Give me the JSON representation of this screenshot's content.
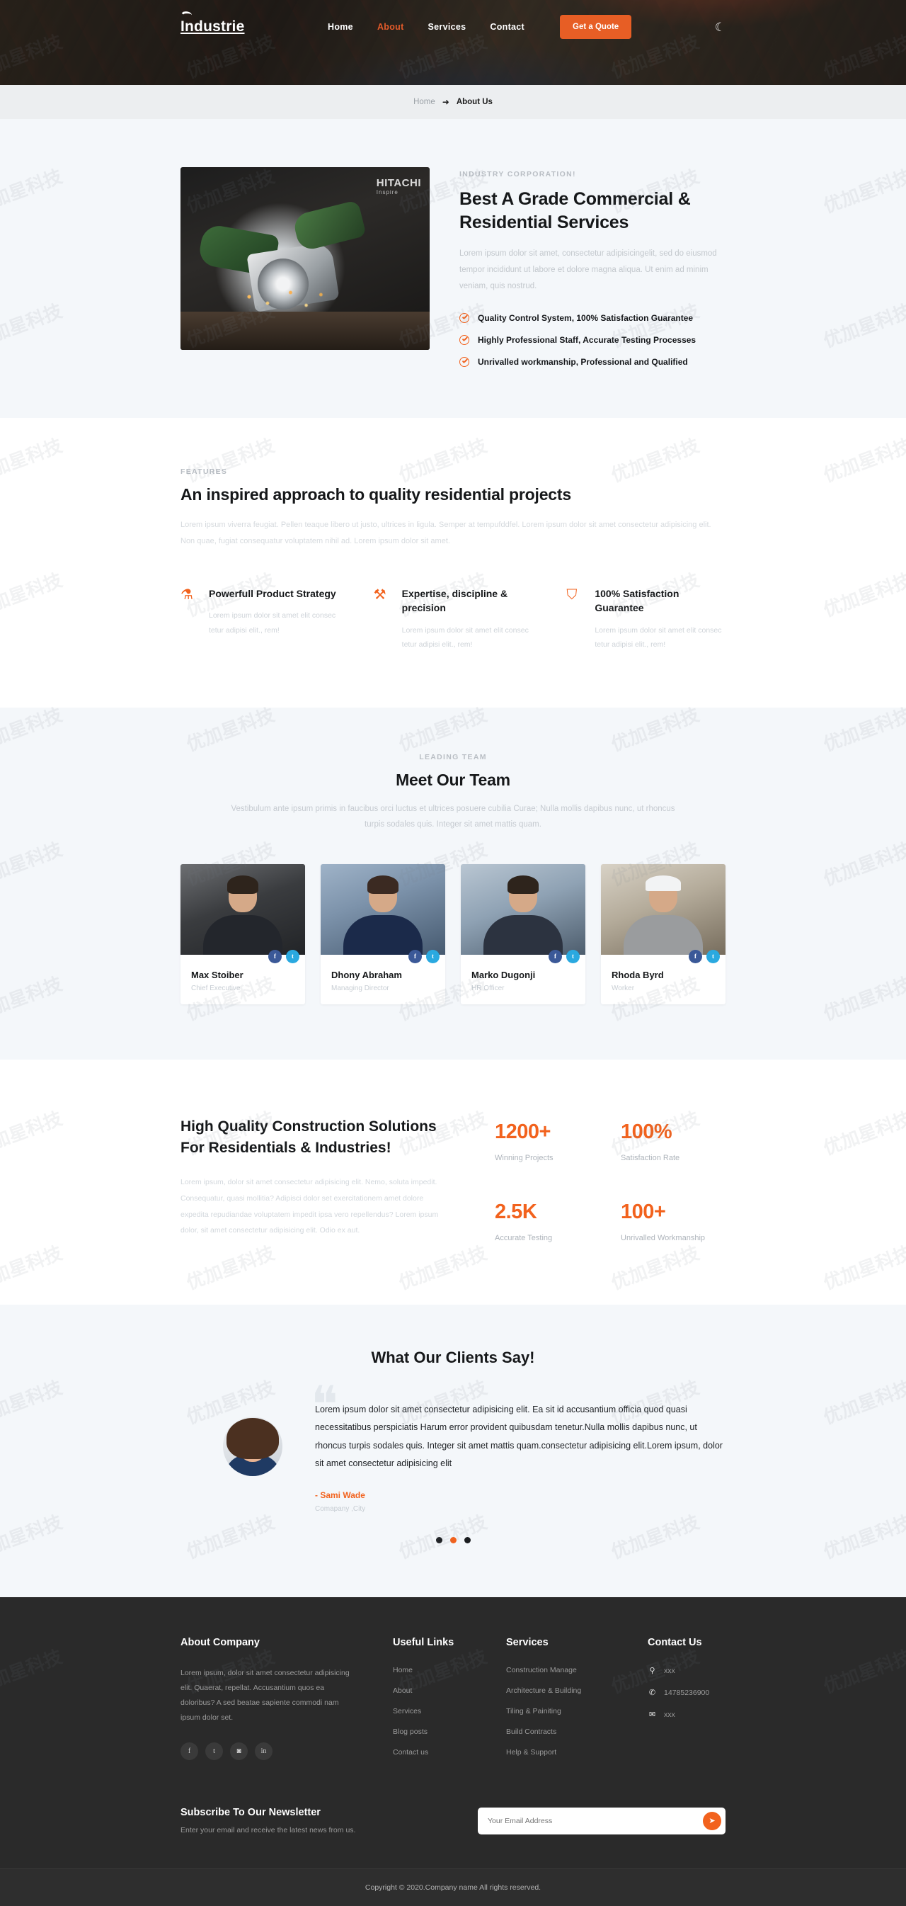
{
  "brand": {
    "name": "Industrie",
    "accent": "#f2621d"
  },
  "nav": {
    "links": [
      {
        "label": "Home",
        "active": false
      },
      {
        "label": "About",
        "active": true
      },
      {
        "label": "Services",
        "active": false
      },
      {
        "label": "Contact",
        "active": false
      }
    ],
    "cta": "Get a Quote",
    "theme_toggle_icon": "moon-icon"
  },
  "breadcrumb": {
    "home": "Home",
    "separator": "➜",
    "current": "About Us"
  },
  "about": {
    "eyebrow": "INDUSTRY CORPORATION!",
    "title": "Best A Grade Commercial & Residential Services",
    "paragraph": "Lorem ipsum dolor sit amet, consectetur adipisicingelit, sed do eiusmod tempor incididunt ut labore et dolore magna aliqua. Ut enim ad minim veniam, quis nostrud.",
    "image_brand": "HITACHI",
    "image_brand_sub": "Inspire",
    "checklist": [
      "Quality Control System, 100% Satisfaction Guarantee",
      "Highly Professional Staff, Accurate Testing Processes",
      "Unrivalled workmanship, Professional and Qualified"
    ]
  },
  "features": {
    "eyebrow": "FEATURES",
    "title": "An inspired approach to quality residential projects",
    "intro": "Lorem ipsum viverra feugiat. Pellen teaque libero ut justo, ultrices in ligula. Semper at tempufddfel. Lorem ipsum dolor sit amet consectetur adipisicing elit. Non quae, fugiat consequatur voluptatem nihil ad. Lorem ipsum dolor sit amet.",
    "items": [
      {
        "icon": "strategy-icon",
        "glyph": "⚗",
        "title": "Powerfull Product Strategy",
        "desc": "Lorem ipsum dolor sit amet elit consec tetur adipisi elit., rem!"
      },
      {
        "icon": "precision-icon",
        "glyph": "⚒",
        "title": "Expertise, discipline & precision",
        "desc": "Lorem ipsum dolor sit amet elit consec tetur adipisi elit., rem!"
      },
      {
        "icon": "shield-icon",
        "glyph": "⛉",
        "title": "100% Satisfaction Guarantee",
        "desc": "Lorem ipsum dolor sit amet elit consec tetur adipisi elit., rem!"
      }
    ]
  },
  "team": {
    "eyebrow": "LEADING TEAM",
    "title": "Meet Our Team",
    "subtitle": "Vestibulum ante ipsum primis in faucibus orci luctus et ultrices posuere cubilia Curae; Nulla mollis dapibus nunc, ut rhoncus turpis sodales quis. Integer sit amet mattis quam.",
    "members": [
      {
        "name": "Max Stoiber",
        "role": "Chief Executive",
        "facebook": "f",
        "twitter": "t"
      },
      {
        "name": "Dhony Abraham",
        "role": "Managing Director",
        "facebook": "f",
        "twitter": "t"
      },
      {
        "name": "Marko Dugonji",
        "role": "HR Officer",
        "facebook": "f",
        "twitter": "t"
      },
      {
        "name": "Rhoda Byrd",
        "role": "Worker",
        "facebook": "f",
        "twitter": "t"
      }
    ]
  },
  "stats": {
    "title": "High Quality Construction Solutions For Residentials & Industries!",
    "paragraph": "Lorem ipsum, dolor sit amet consectetur adipisicing elit. Nemo, soluta impedit. Consequatur, quasi mollitia? Adipisci dolor set exercitationem amet dolore expedita repudiandae voluptatem impedit ipsa vero repellendus? Lorem ipsum dolor, sit amet consectetur adipisicing elit. Odio ex aut.",
    "items": [
      {
        "value": "1200+",
        "label": "Winning Projects"
      },
      {
        "value": "100%",
        "label": "Satisfaction Rate"
      },
      {
        "value": "2.5K",
        "label": "Accurate Testing"
      },
      {
        "value": "100+",
        "label": "Unrivalled Workmanship"
      }
    ]
  },
  "testimonials": {
    "title": "What Our Clients Say!",
    "quote_mark": "❝",
    "current": {
      "text": "Lorem ipsum dolor sit amet consectetur adipisicing elit. Ea sit id accusantium officia quod quasi necessitatibus perspiciatis Harum error provident quibusdam tenetur.Nulla mollis dapibus nunc, ut rhoncus turpis sodales quis. Integer sit amet mattis quam.consectetur adipisicing elit.Lorem ipsum, dolor sit amet consectetur adipisicing elit",
      "author": "- Sami Wade",
      "company": "Comapany ,City"
    },
    "dots": [
      {
        "active": false
      },
      {
        "active": true
      },
      {
        "active": false
      }
    ]
  },
  "footer": {
    "about": {
      "heading": "About Company",
      "text": "Lorem ipsum, dolor sit amet consectetur adipisicing elit. Quaerat, repellat. Accusantium quos ea doloribus? A sed beatae sapiente commodi nam ipsum dolor set.",
      "socials": [
        {
          "name": "facebook-icon",
          "glyph": "f"
        },
        {
          "name": "twitter-icon",
          "glyph": "t"
        },
        {
          "name": "instagram-icon",
          "glyph": "◙"
        },
        {
          "name": "linkedin-icon",
          "glyph": "in"
        }
      ]
    },
    "useful_links": {
      "heading": "Useful Links",
      "links": [
        "Home",
        "About",
        "Services",
        "Blog posts",
        "Contact us"
      ]
    },
    "services": {
      "heading": "Services",
      "links": [
        "Construction Manage",
        "Architecture & Building",
        "Tiling & Painiting",
        "Build Contracts",
        "Help & Support"
      ]
    },
    "contact": {
      "heading": "Contact Us",
      "items": [
        {
          "icon": "location-pin-icon",
          "glyph": "⚲",
          "value": "xxx"
        },
        {
          "icon": "phone-icon",
          "glyph": "✆",
          "value": "14785236900"
        },
        {
          "icon": "envelope-icon",
          "glyph": "✉",
          "value": "xxx"
        }
      ]
    },
    "newsletter": {
      "heading": "Subscribe To Our Newsletter",
      "subtext": "Enter your email and receive the latest news from us.",
      "placeholder": "Your Email Address",
      "value": "",
      "submit_icon": "send-icon",
      "submit_glyph": "➤"
    },
    "copyright": "Copyright © 2020.Company name All rights reserved."
  },
  "watermark": "优加星科技"
}
